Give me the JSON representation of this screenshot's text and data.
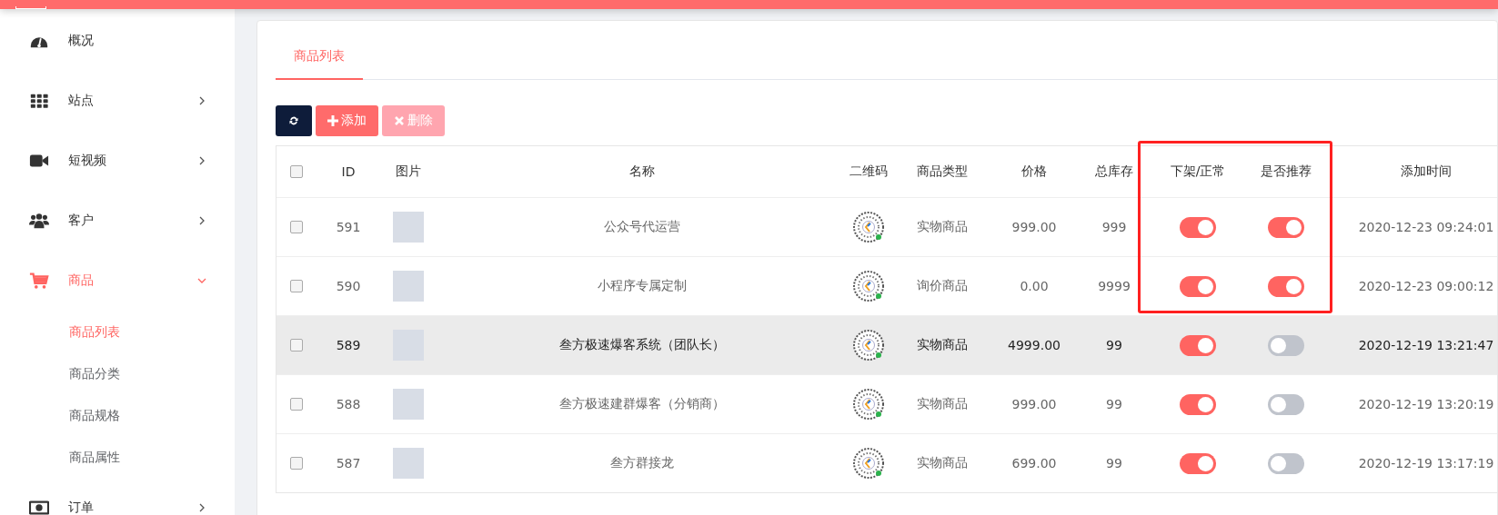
{
  "sidebar": {
    "items": [
      {
        "label": "概况",
        "has_children": false,
        "selected": false
      },
      {
        "label": "站点",
        "has_children": true,
        "expanded": false,
        "selected": false
      },
      {
        "label": "短视频",
        "has_children": true,
        "expanded": false,
        "selected": false
      },
      {
        "label": "客户",
        "has_children": true,
        "expanded": false,
        "selected": false
      },
      {
        "label": "商品",
        "has_children": true,
        "expanded": true,
        "selected": true,
        "children": [
          {
            "label": "商品列表",
            "selected": true
          },
          {
            "label": "商品分类",
            "selected": false
          },
          {
            "label": "商品规格",
            "selected": false
          },
          {
            "label": "商品属性",
            "selected": false
          }
        ]
      },
      {
        "label": "订单",
        "has_children": true,
        "expanded": false,
        "selected": false
      }
    ]
  },
  "tabs": [
    {
      "label": "商品列表",
      "selected": true
    }
  ],
  "toolbar": [
    {
      "kind": "refresh",
      "disabled": false
    },
    {
      "kind": "add",
      "label": "添加",
      "disabled": false
    },
    {
      "kind": "delete",
      "label": "删除",
      "disabled": true
    }
  ],
  "table": {
    "columns": [
      "ID",
      "图片",
      "名称",
      "二维码",
      "商品类型",
      "价格",
      "总库存",
      "下架/正常",
      "是否推荐",
      "添加时间"
    ],
    "header_checked": false,
    "rows": [
      {
        "checked": false,
        "highlighted": false,
        "id": "591",
        "name": "公众号代运营",
        "type": "实物商品",
        "price": "999.00",
        "stock": "999",
        "listed": true,
        "recommended": true,
        "added": "2020-12-23 09:24:01"
      },
      {
        "checked": false,
        "highlighted": false,
        "id": "590",
        "name": "小程序专属定制",
        "type": "询价商品",
        "price": "0.00",
        "stock": "9999",
        "listed": true,
        "recommended": true,
        "added": "2020-12-23 09:00:12"
      },
      {
        "checked": false,
        "highlighted": true,
        "id": "589",
        "name": "叁方极速爆客系统（团队长）",
        "type": "实物商品",
        "price": "4999.00",
        "stock": "99",
        "listed": true,
        "recommended": false,
        "added": "2020-12-19 13:21:47"
      },
      {
        "checked": false,
        "highlighted": false,
        "id": "588",
        "name": "叁方极速建群爆客（分销商）",
        "type": "实物商品",
        "price": "999.00",
        "stock": "99",
        "listed": true,
        "recommended": false,
        "added": "2020-12-19 13:20:19"
      },
      {
        "checked": false,
        "highlighted": false,
        "id": "587",
        "name": "叁方群接龙",
        "type": "实物商品",
        "price": "699.00",
        "stock": "99",
        "listed": true,
        "recommended": false,
        "added": "2020-12-19 13:17:19"
      }
    ]
  }
}
